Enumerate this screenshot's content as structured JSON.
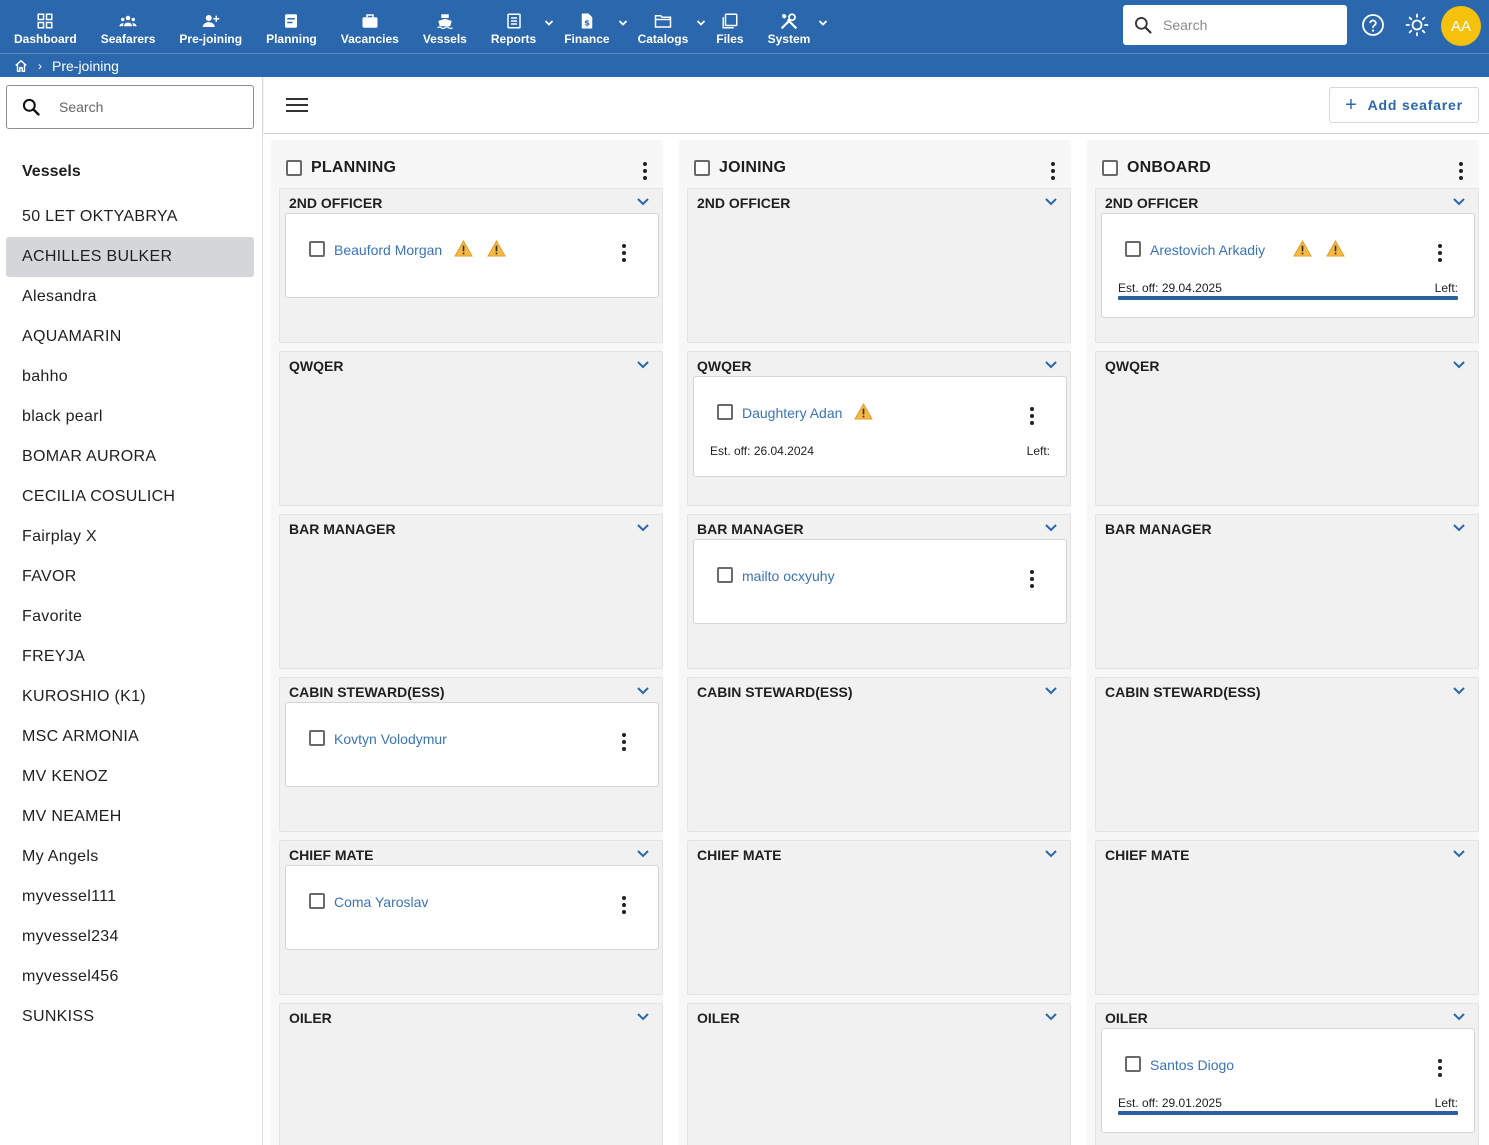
{
  "nav": {
    "items": [
      {
        "label": "Dashboard",
        "icon": "dashboard-icon",
        "caret": false
      },
      {
        "label": "Seafarers",
        "icon": "people-icon",
        "caret": false
      },
      {
        "label": "Pre-joining",
        "icon": "person-add-icon",
        "caret": false
      },
      {
        "label": "Planning",
        "icon": "planning-icon",
        "caret": false
      },
      {
        "label": "Vacancies",
        "icon": "briefcase-icon",
        "caret": false
      },
      {
        "label": "Vessels",
        "icon": "ship-icon",
        "caret": false
      },
      {
        "label": "Reports",
        "icon": "report-icon",
        "caret": true
      },
      {
        "label": "Finance",
        "icon": "finance-icon",
        "caret": true
      },
      {
        "label": "Catalogs",
        "icon": "folder-icon",
        "caret": true
      },
      {
        "label": "Files",
        "icon": "files-icon",
        "caret": false
      },
      {
        "label": "System",
        "icon": "tools-icon",
        "caret": true
      }
    ],
    "search_placeholder": "Search",
    "avatar_initials": "AA",
    "avatar_color": "#f4c20d",
    "bar_color": "#2a67ad"
  },
  "breadcrumb": {
    "current": "Pre-joining"
  },
  "sidebar": {
    "search_placeholder": "Search",
    "title": "Vessels",
    "items": [
      "50 LET OKTYABRYA",
      "ACHILLES BULKER",
      "Alesandra",
      "AQUAMARIN",
      "bahho",
      "black pearl",
      "BOMAR AURORA",
      "CECILIA COSULICH",
      "Fairplay X",
      "FAVOR",
      "Favorite",
      "FREYJA",
      "KUROSHIO (K1)",
      "MSC ARMONIA",
      "MV KENOZ",
      "MV NEAMEH",
      "My Angels",
      "myvessel111",
      "myvessel234",
      "myvessel456",
      "SUNKISS"
    ],
    "selected_index": 1
  },
  "toolbar": {
    "add_label": "Add seafarer"
  },
  "columns": [
    {
      "title": "PLANNING",
      "groups": [
        {
          "title": "2ND OFFICER",
          "cards": [
            {
              "name": "Beauford Morgan",
              "warnings": 2
            }
          ]
        },
        {
          "title": "QWQER",
          "cards": []
        },
        {
          "title": "BAR MANAGER",
          "cards": []
        },
        {
          "title": "CABIN STEWARD(ESS)",
          "cards": [
            {
              "name": "Kovtyn Volodymur",
              "warnings": 0
            }
          ]
        },
        {
          "title": "CHIEF MATE",
          "cards": [
            {
              "name": "Coma Yaroslav",
              "warnings": 0
            }
          ]
        },
        {
          "title": "OILER",
          "cards": []
        }
      ]
    },
    {
      "title": "JOINING",
      "groups": [
        {
          "title": "2ND OFFICER",
          "cards": []
        },
        {
          "title": "QWQER",
          "cards": [
            {
              "name": "Daughtery Adan",
              "warnings": 1,
              "est_label": "Est. off:",
              "est_date": "26.04.2024",
              "left_label": "Left:"
            }
          ]
        },
        {
          "title": "BAR MANAGER",
          "cards": [
            {
              "name": "mailto ocxyuhy",
              "warnings": 0
            }
          ]
        },
        {
          "title": "CABIN STEWARD(ESS)",
          "cards": []
        },
        {
          "title": "CHIEF MATE",
          "cards": []
        },
        {
          "title": "OILER",
          "cards": []
        }
      ]
    },
    {
      "title": "ONBOARD",
      "groups": [
        {
          "title": "2ND OFFICER",
          "cards": [
            {
              "name": "Arestovich Arkadiy",
              "warnings": 2,
              "est_label": "Est. off:",
              "est_date": "29.04.2025",
              "left_label": "Left:",
              "progress": 1.0
            }
          ]
        },
        {
          "title": "QWQER",
          "cards": []
        },
        {
          "title": "BAR MANAGER",
          "cards": []
        },
        {
          "title": "CABIN STEWARD(ESS)",
          "cards": []
        },
        {
          "title": "CHIEF MATE",
          "cards": []
        },
        {
          "title": "OILER",
          "cards": [
            {
              "name": "Santos Diogo",
              "warnings": 0,
              "est_label": "Est. off:",
              "est_date": "29.01.2025",
              "left_label": "Left:",
              "progress": 1.0
            }
          ]
        }
      ]
    }
  ]
}
